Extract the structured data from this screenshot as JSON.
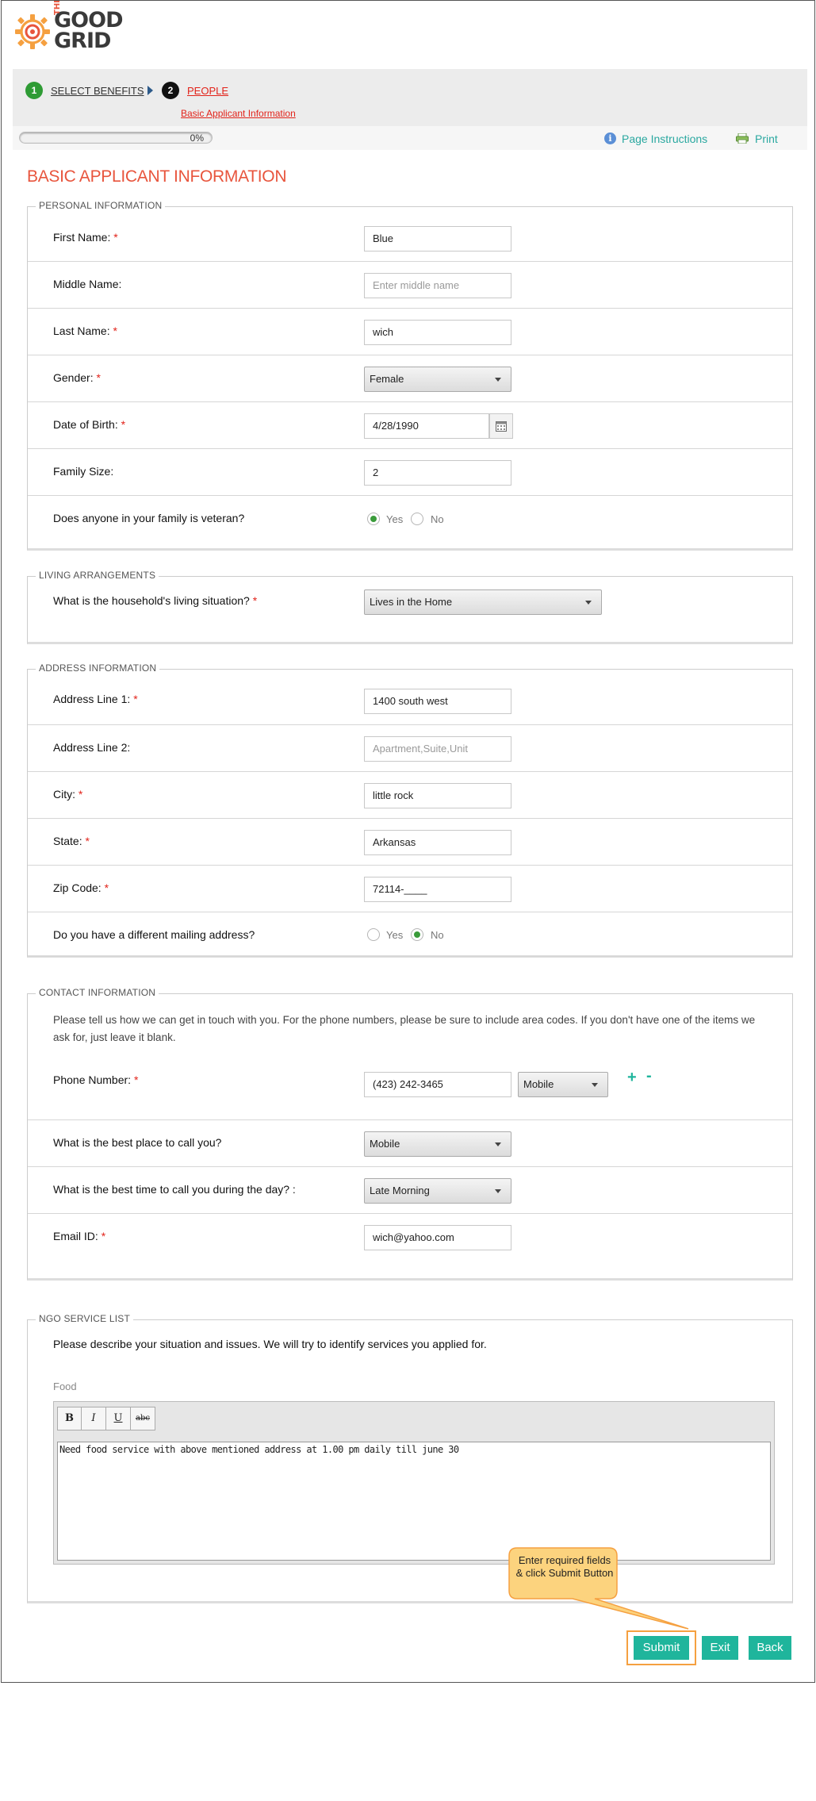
{
  "brand": {
    "name": "THE GOOD GRID",
    "the": "THE",
    "good": "GOOD",
    "grid": "GRID"
  },
  "wizard": {
    "steps": [
      {
        "num": "1",
        "label": "SELECT BENEFITS"
      },
      {
        "num": "2",
        "label": "PEOPLE"
      }
    ],
    "sub_step": "Basic Applicant Information"
  },
  "progress": {
    "percent": 0,
    "text": "0%"
  },
  "toolbar": {
    "instructions": "Page Instructions",
    "print": "Print"
  },
  "page_title": "BASIC APPLICANT INFORMATION",
  "personal": {
    "legend": "PERSONAL INFORMATION",
    "first_name": {
      "label": "First Name:",
      "value": "Blue"
    },
    "middle_name": {
      "label": "Middle Name:",
      "placeholder": "Enter middle name"
    },
    "last_name": {
      "label": "Last Name:",
      "value": "wich"
    },
    "gender": {
      "label": "Gender:",
      "value": "Female"
    },
    "dob": {
      "label": "Date of Birth:",
      "value": "4/28/1990"
    },
    "family_size": {
      "label": "Family Size:",
      "value": "2"
    },
    "veteran": {
      "label": "Does anyone in your family is veteran?",
      "yes": "Yes",
      "no": "No",
      "selected": "Yes"
    }
  },
  "living": {
    "legend": "LIVING ARRANGEMENTS",
    "situation": {
      "label": "What is the household's living situation?",
      "value": "Lives in the Home"
    }
  },
  "address": {
    "legend": "ADDRESS INFORMATION",
    "line1": {
      "label": "Address Line 1:",
      "value": "1400 south west"
    },
    "line2": {
      "label": "Address Line 2:",
      "placeholder": "Apartment,Suite,Unit"
    },
    "city": {
      "label": "City:",
      "value": "little rock"
    },
    "state": {
      "label": "State:",
      "value": "Arkansas"
    },
    "zip": {
      "label": "Zip Code:",
      "value": "72114-____"
    },
    "mailing": {
      "label": "Do you have a different mailing address?",
      "yes": "Yes",
      "no": "No",
      "selected": "No"
    }
  },
  "contact": {
    "legend": "CONTACT INFORMATION",
    "intro": "Please tell us how we can get in touch with you. For the phone numbers, please be sure to include area codes. If you don't have one of the items we ask for, just leave it blank.",
    "phone": {
      "label": "Phone Number:",
      "value": "(423) 242-3465",
      "type": "Mobile",
      "add": "+",
      "remove": "-"
    },
    "best_place": {
      "label": "What is the best place to call you?",
      "value": "Mobile"
    },
    "best_time": {
      "label": "What is the best time to call you during the day? :",
      "value": "Late Morning"
    },
    "email": {
      "label": "Email ID:",
      "value": "wich@yahoo.com"
    }
  },
  "ngo": {
    "legend": "NGO SERVICE LIST",
    "prompt": "Please describe your situation and issues. We will try to identify services you applied for.",
    "service": "Food",
    "editor": {
      "bold": "B",
      "italic": "I",
      "underline": "U",
      "strike": "abc",
      "text": "Need food service with above mentioned address at 1.00 pm daily till june 30"
    }
  },
  "callout": "Enter required fields & click Submit Button",
  "buttons": {
    "submit": "Submit",
    "exit": "Exit",
    "back": "Back"
  },
  "required_mark": "*",
  "colors": {
    "accent": "#1fb59c",
    "title": "#e8553d",
    "required": "#e2231a",
    "step_done": "#2e9b34",
    "callout_fill": "#fcd37e",
    "callout_border": "#f5a040"
  }
}
